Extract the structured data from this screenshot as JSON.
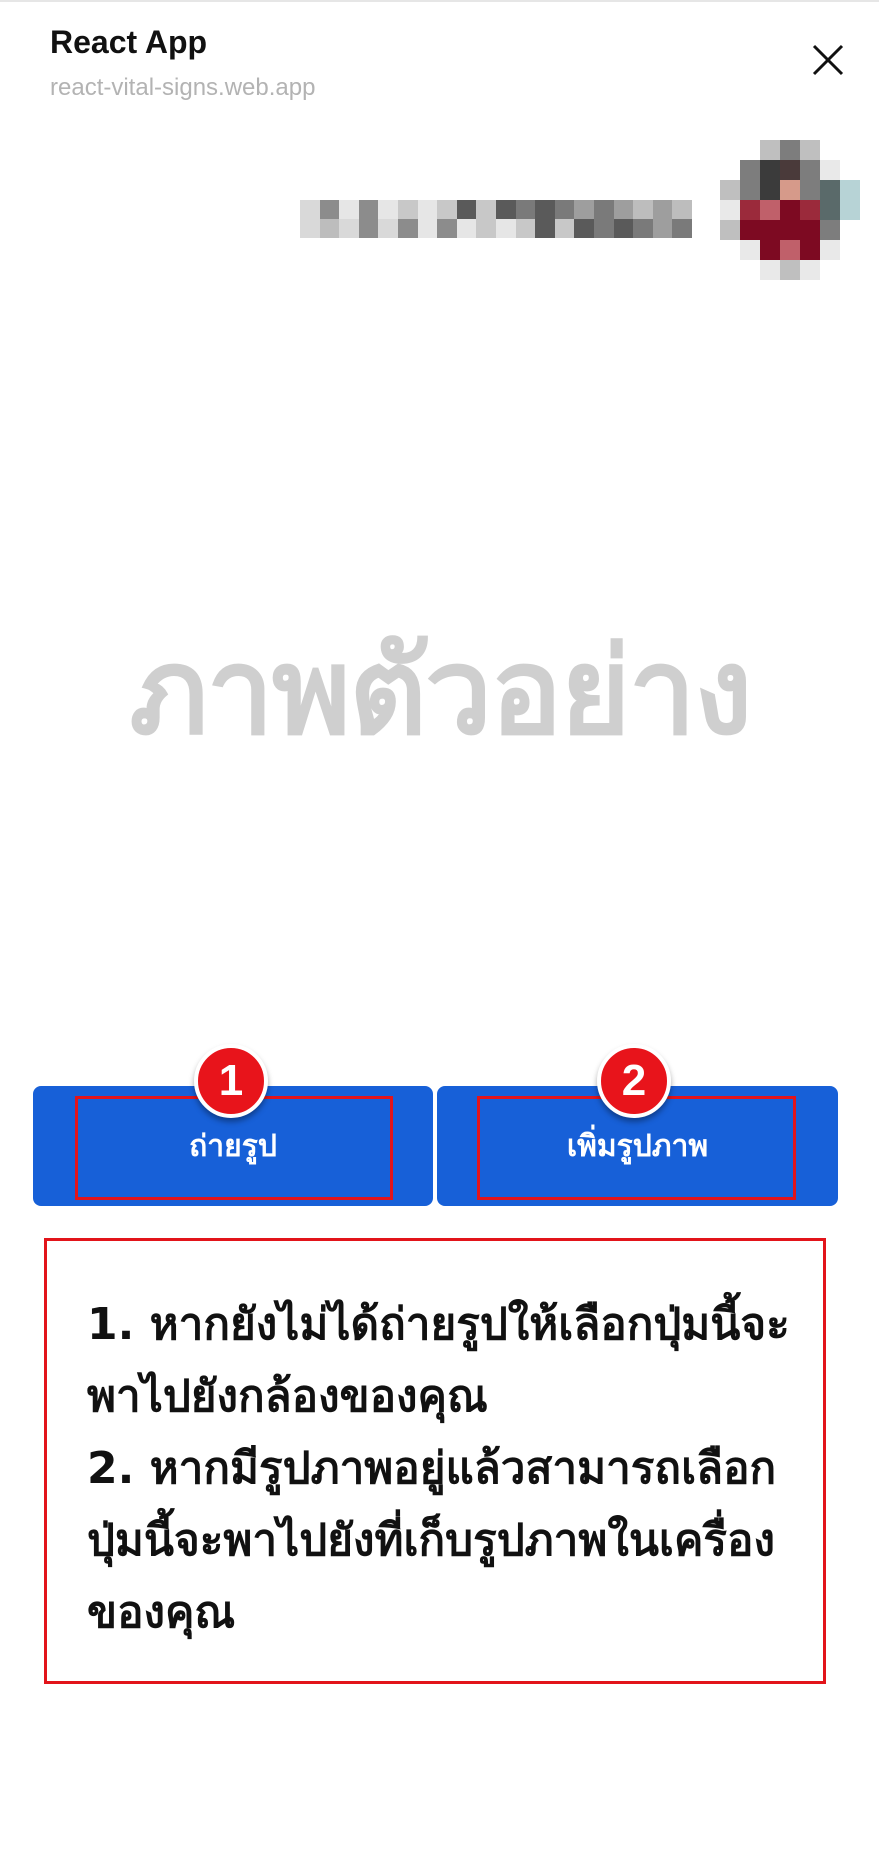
{
  "header": {
    "title": "React App",
    "url": "react-vital-signs.web.app"
  },
  "icons": {
    "close": "close-icon"
  },
  "preview": {
    "label": "ภาพตัวอย่าง"
  },
  "buttons": {
    "take_photo": "ถ่ายรูป",
    "add_photo": "เพิ่มรูปภาพ"
  },
  "markers": {
    "first": "1",
    "second": "2"
  },
  "instructions": {
    "item1": "1. หากยังไม่ได้ถ่ายรูปให้เลือกปุ่มนี้จะพาไปยังกล้องของคุณ",
    "item2": "2. หากมีรูปภาพอยู่แล้วสามารถเลือกปุ่มนี้จะพาไปยังที่เก็บรูปภาพในเครื่องของคุณ"
  },
  "colors": {
    "primary": "#1760d8",
    "highlight": "#e2141a",
    "preview_text": "#cfcfcf"
  }
}
